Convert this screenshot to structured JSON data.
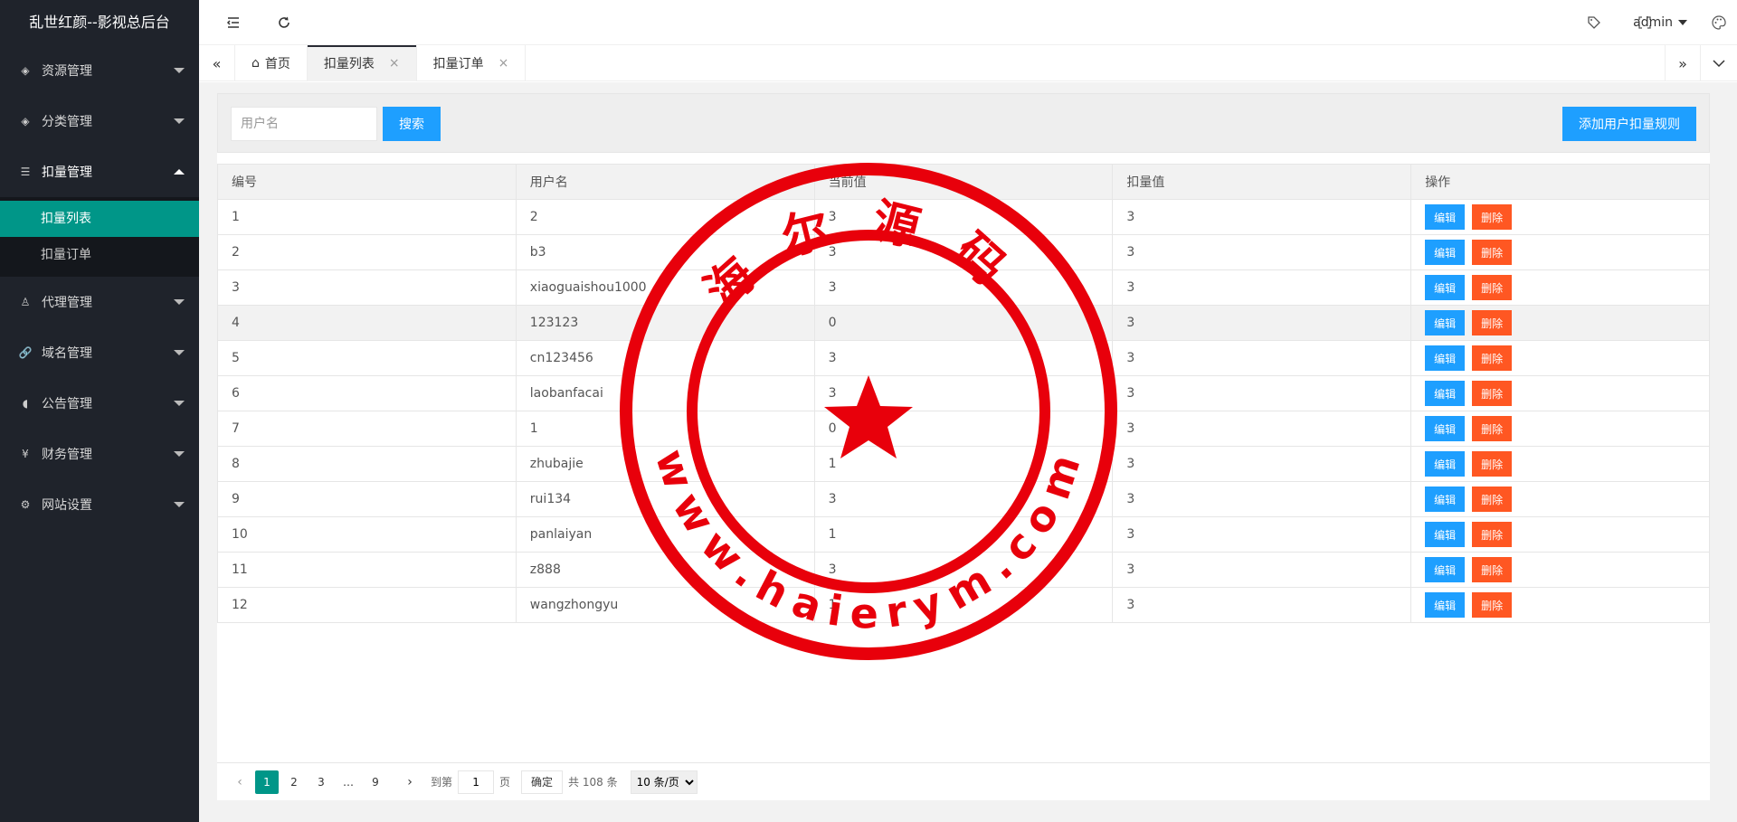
{
  "app": {
    "title": "乱世红颜--影视总后台"
  },
  "sidebar": {
    "items": [
      {
        "label": "资源管理",
        "icon": "layers-icon"
      },
      {
        "label": "分类管理",
        "icon": "layers-icon"
      },
      {
        "label": "扣量管理",
        "icon": "list-icon",
        "open": true,
        "children": [
          {
            "label": "扣量列表",
            "active": true
          },
          {
            "label": "扣量订单"
          }
        ]
      },
      {
        "label": "代理管理",
        "icon": "user-icon"
      },
      {
        "label": "域名管理",
        "icon": "link-icon"
      },
      {
        "label": "公告管理",
        "icon": "speaker-icon"
      },
      {
        "label": "财务管理",
        "icon": "yen-icon"
      },
      {
        "label": "网站设置",
        "icon": "gear-icon"
      }
    ]
  },
  "header": {
    "user": "admin"
  },
  "tabs": [
    {
      "label": "首页"
    },
    {
      "label": "扣量列表",
      "active": true
    },
    {
      "label": "扣量订单"
    }
  ],
  "search": {
    "placeholder": "用户名",
    "button": "搜索",
    "add_button": "添加用户扣量规则"
  },
  "table": {
    "headers": [
      "编号",
      "用户名",
      "当前值",
      "扣量值",
      "操作"
    ],
    "edit_label": "编辑",
    "delete_label": "删除",
    "rows": [
      [
        "1",
        "2",
        "3",
        "3"
      ],
      [
        "2",
        "b3",
        "3",
        "3"
      ],
      [
        "3",
        "xiaoguaishou1000",
        "3",
        "3"
      ],
      [
        "4",
        "123123",
        "0",
        "3"
      ],
      [
        "5",
        "cn123456",
        "3",
        "3"
      ],
      [
        "6",
        "laobanfacai",
        "3",
        "3"
      ],
      [
        "7",
        "1",
        "0",
        "3"
      ],
      [
        "8",
        "zhubajie",
        "1",
        "3"
      ],
      [
        "9",
        "rui134",
        "3",
        "3"
      ],
      [
        "10",
        "panlaiyan",
        "1",
        "3"
      ],
      [
        "11",
        "z888",
        "3",
        "3"
      ],
      [
        "12",
        "wangzhongyu",
        "1",
        "3"
      ]
    ]
  },
  "pagination": {
    "pages": [
      "1",
      "2",
      "3",
      "…",
      "9"
    ],
    "goto_label": "到第",
    "page_value": "1",
    "page_unit": "页",
    "confirm": "确定",
    "total": "共 108 条",
    "page_size": "10 条/页"
  },
  "watermark": {
    "text_top": "海尔源码",
    "text_bottom": "www.haierym.com",
    "color": "#e8000b"
  }
}
